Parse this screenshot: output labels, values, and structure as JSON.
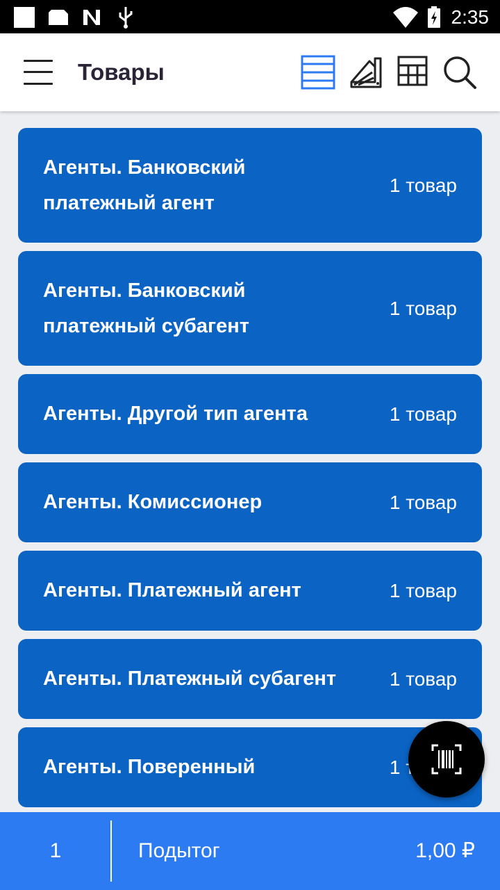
{
  "status_bar": {
    "time": "2:35"
  },
  "header": {
    "title": "Товары"
  },
  "toolbar": {
    "icons": [
      "list-view-icon",
      "palette-icon",
      "grid-view-icon",
      "search-icon"
    ],
    "active_color": "#2c7bf2"
  },
  "items": [
    {
      "title": "Агенты. Банковский платежный агент",
      "count": "1 товар"
    },
    {
      "title": "Агенты. Банковский платежный субагент",
      "count": "1 товар"
    },
    {
      "title": "Агенты. Другой тип агента",
      "count": "1 товар"
    },
    {
      "title": "Агенты. Комиссионер",
      "count": "1 товар"
    },
    {
      "title": "Агенты. Платежный агент",
      "count": "1 товар"
    },
    {
      "title": "Агенты. Платежный субагент",
      "count": "1 товар"
    },
    {
      "title": "Агенты. Поверенный",
      "count": "1 товар"
    }
  ],
  "footer": {
    "quantity": "1",
    "subtotal_label": "Подытог",
    "subtotal_value": "1,00 ₽"
  },
  "colors": {
    "card": "#0b63c4",
    "footer": "#2c7bf2",
    "fab": "#000000"
  }
}
